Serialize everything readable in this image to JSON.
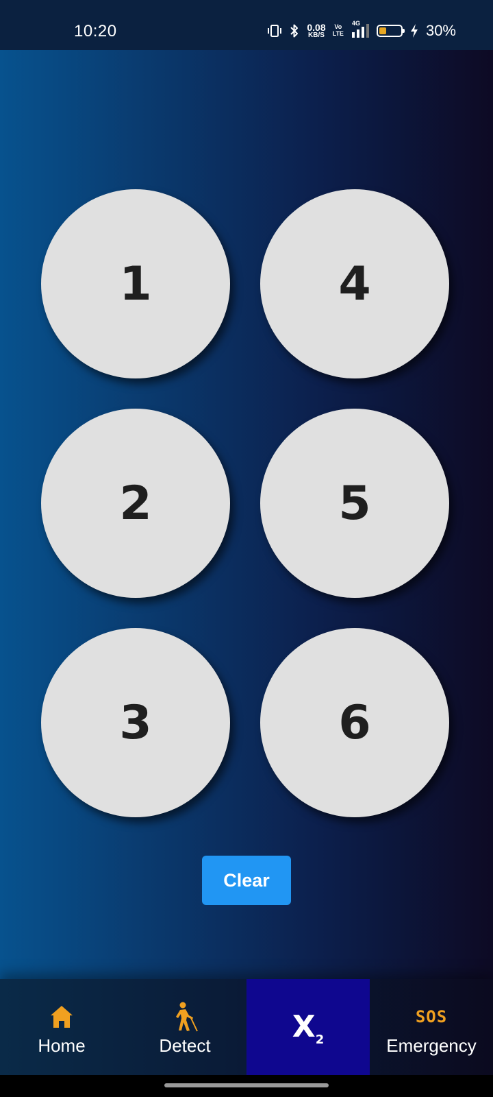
{
  "status_bar": {
    "time": "10:20",
    "net_speed_value": "0.08",
    "net_speed_unit": "KB/S",
    "volte_top": "Vo",
    "volte_bottom": "LTE",
    "network": "4G",
    "battery_percent_text": "30%",
    "battery_level": 0.3,
    "battery_color": "#e5a623",
    "icons": [
      "vibrate-icon",
      "bluetooth-icon",
      "signal-icon",
      "battery-icon",
      "charging-icon"
    ]
  },
  "keypad": {
    "buttons": [
      {
        "label": "1"
      },
      {
        "label": "4"
      },
      {
        "label": "2"
      },
      {
        "label": "5"
      },
      {
        "label": "3"
      },
      {
        "label": "6"
      }
    ]
  },
  "clear_button": {
    "label": "Clear",
    "color": "#2196f3"
  },
  "bottom_nav": {
    "items": [
      {
        "label": "Home",
        "icon": "home-icon",
        "active": false
      },
      {
        "label": "Detect",
        "icon": "blind-walker-icon",
        "active": false
      },
      {
        "label": "",
        "icon": "x2-icon",
        "icon_text": "X",
        "icon_sub": "2",
        "active": true
      },
      {
        "label": "Emergency",
        "icon": "sos-icon",
        "icon_text": "SOS",
        "active": false
      }
    ],
    "accent_color": "#f0a020",
    "active_bg": "#0f078f"
  }
}
